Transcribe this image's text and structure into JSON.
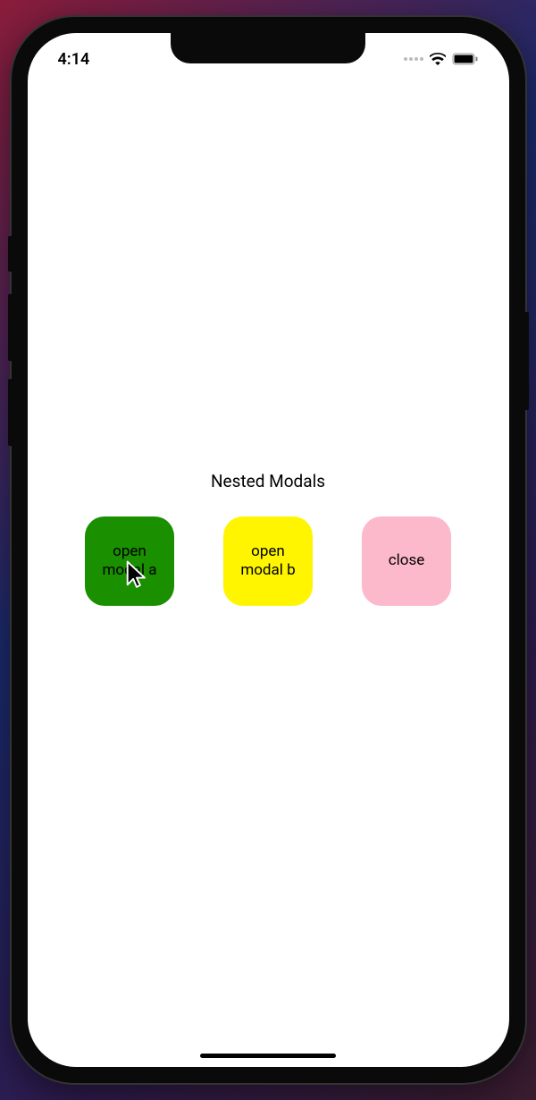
{
  "status_bar": {
    "time": "4:14"
  },
  "title": "Nested Modals",
  "buttons": {
    "a": "open modal a",
    "b": "open modal b",
    "close": "close"
  },
  "colors": {
    "button_a": "#1a8f00",
    "button_b": "#fff500",
    "button_close": "#fbb9cb"
  }
}
